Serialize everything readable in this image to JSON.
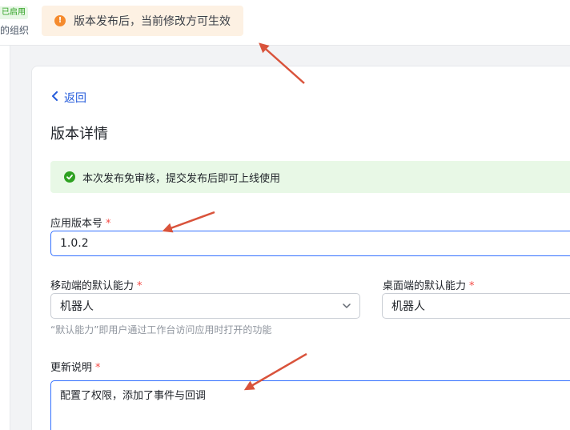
{
  "top": {
    "enabled_badge": "已启用",
    "org_text": "的组织",
    "toast_text": "版本发布后，当前修改方可生效"
  },
  "card": {
    "back_label": "返回",
    "page_title": "版本详情",
    "notice_text": "本次发布免审核，提交发布后即可上线使用",
    "version": {
      "label": "应用版本号",
      "required": "*",
      "value": "1.0.2"
    },
    "mobile_default": {
      "label": "移动端的默认能力",
      "required": "*",
      "value": "机器人"
    },
    "desktop_default": {
      "label": "桌面端的默认能力",
      "required": "*",
      "value": "机器人"
    },
    "default_hint": "“默认能力”即用户通过工作台访问应用时打开的功能",
    "update_notes": {
      "label": "更新说明",
      "required": "*",
      "value": "配置了权限，添加了事件与回调"
    }
  },
  "colors": {
    "accent": "#3370ff",
    "link": "#245bdb",
    "warning_bg": "#fdf1e3",
    "warning_icon": "#f58b2e",
    "success_bg": "#e8f8e6",
    "success_icon": "#2ea121",
    "required": "#f54a45",
    "annotation_arrow": "#d9533b"
  },
  "icons": {
    "toast": "warning-circle-icon",
    "notice": "check-circle-icon",
    "back": "chevron-left-icon",
    "select": "chevron-down-icon"
  }
}
